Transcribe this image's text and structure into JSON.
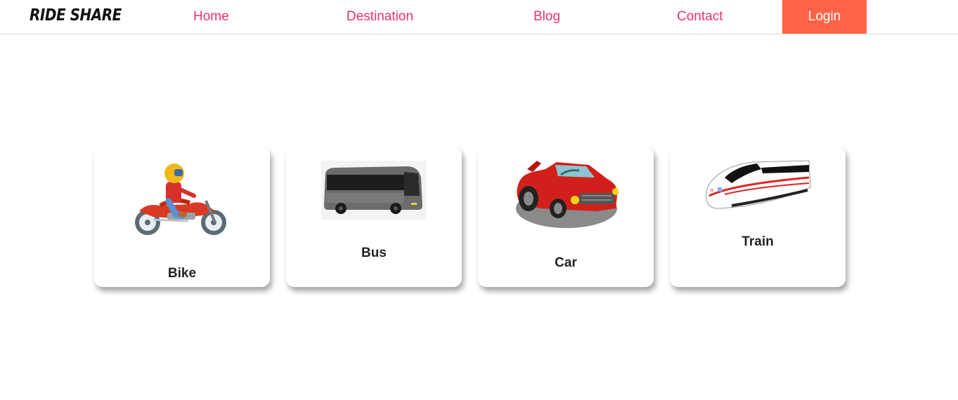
{
  "navbar": {
    "logo": "RIDE SHARE",
    "links": [
      "Home",
      "Destination",
      "Blog",
      "Contact"
    ],
    "login_label": "Login"
  },
  "vehicles": [
    {
      "label": "Bike",
      "icon": "motorcycle-icon"
    },
    {
      "label": "Bus",
      "icon": "bus-icon"
    },
    {
      "label": "Car",
      "icon": "car-icon"
    },
    {
      "label": "Train",
      "icon": "train-icon"
    }
  ],
  "colors": {
    "nav_link": "#e8336b",
    "login_bg": "#ff6347"
  }
}
